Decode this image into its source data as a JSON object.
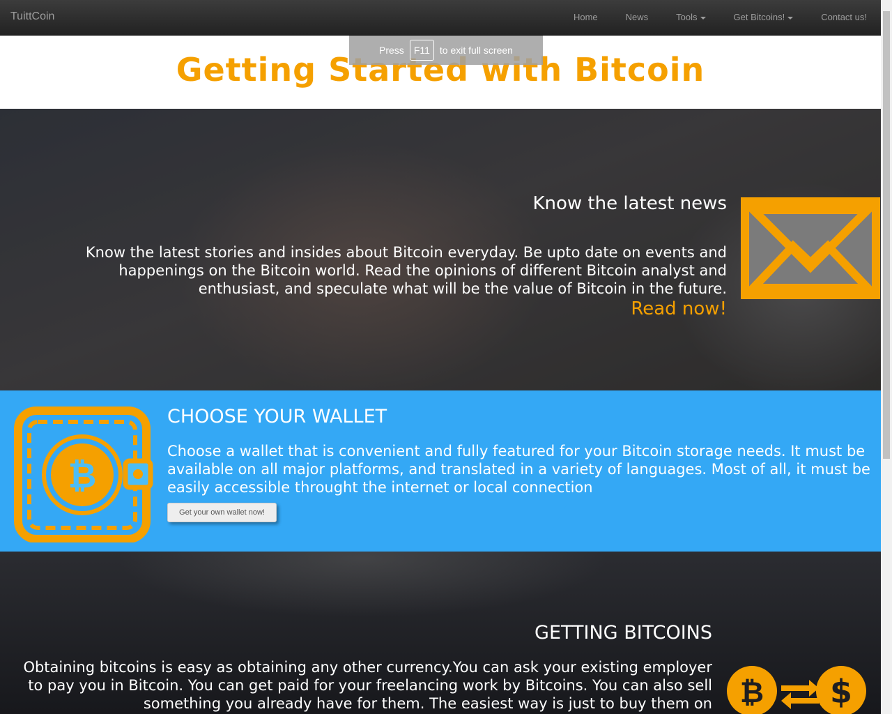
{
  "navbar": {
    "brand": "TuittCoin",
    "items": [
      {
        "label": "Home",
        "dropdown": false
      },
      {
        "label": "News",
        "dropdown": false
      },
      {
        "label": "Tools",
        "dropdown": true
      },
      {
        "label": "Get Bitcoins!",
        "dropdown": true
      },
      {
        "label": "Contact us!",
        "dropdown": false
      }
    ]
  },
  "fullscreen_notice": {
    "before": "Press",
    "key": "F11",
    "after": "to exit full screen"
  },
  "header": {
    "title": "Getting Started with Bitcoin"
  },
  "news": {
    "title": "Know the latest news",
    "text": "Know the latest stories and insides about Bitcoin everyday. Be upto date on events and happenings on the Bitcoin world. Read the opinions of different Bitcoin analyst and enthusiast, and speculate what will be the value of Bitcoin in the future.",
    "link": "Read now!",
    "icon": "envelope-icon"
  },
  "wallet": {
    "title": "CHOOSE YOUR WALLET",
    "text": "Choose a wallet that is convenient and fully featured for your Bitcoin storage needs. It must be available on all major platforms, and translated in a variety of languages. Most of all, it must be easily accessible throught the internet or local connection",
    "button": "Get your own wallet now!",
    "icon": "bitcoin-wallet-icon"
  },
  "getting": {
    "title": "GETTING BITCOINS",
    "text": "Obtaining bitcoins is easy as obtaining any other currency.You can ask your existing employer to pay you in Bitcoin. You can get paid for your freelancing work by Bitcoins. You can also sell something you already have for them. The easiest way is just to buy them on",
    "icon": "bitcoin-dollar-exchange-icon"
  },
  "colors": {
    "accent": "#f5a000",
    "wallet_bg": "#4dbdf5",
    "wallet_stripe": "#34a8f5"
  }
}
